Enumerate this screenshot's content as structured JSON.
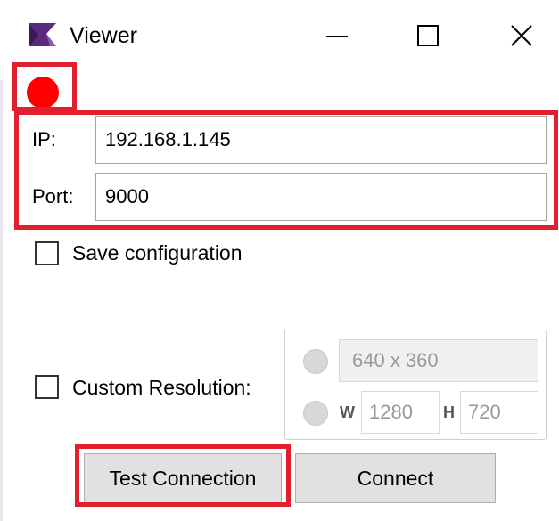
{
  "window": {
    "title": "Viewer",
    "minimize_label": "—",
    "maximize_label": "☐",
    "close_label": "✕"
  },
  "status": {
    "indicator_color": "#ff0000"
  },
  "connection": {
    "ip_label": "IP:",
    "ip_value": "192.168.1.145",
    "port_label": "Port:",
    "port_value": "9000"
  },
  "save_configuration": {
    "label": "Save configuration",
    "checked": false
  },
  "custom_resolution": {
    "label": "Custom Resolution:",
    "checked": false,
    "preset_value": "640 x 360",
    "width_label": "W",
    "width_value": "1280",
    "height_label": "H",
    "height_value": "720"
  },
  "buttons": {
    "test_connection": "Test Connection",
    "connect": "Connect"
  },
  "colors": {
    "highlight": "#e0202e",
    "status_red": "#ff0000",
    "button_bg": "#e1e1e1"
  }
}
